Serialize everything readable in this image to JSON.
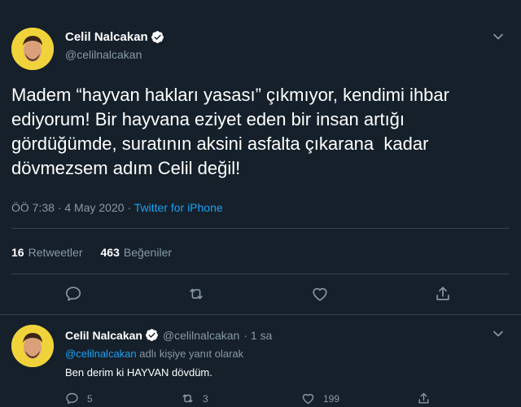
{
  "tweet": {
    "author": {
      "name": "Celil Nalcakan",
      "handle": "@celilnalcakan",
      "verified": true
    },
    "text": "Madem “hayvan hakları yasası” çıkmıyor, kendimi ihbar\nediyorum! Bir hayvana eziyet eden bir insan artığı\ngördüğümde, suratının aksini asfalta çıkarana  kadar\ndövmezsem adım Celil değil!",
    "time_date": "ÖÖ 7:38 · 4 May 2020 · ",
    "source": "Twitter for iPhone",
    "stats": {
      "retweets_count": "16",
      "retweets_label": "Retweetler",
      "likes_count": "463",
      "likes_label": "Beğeniler"
    },
    "actions": [
      "reply-icon",
      "retweet-icon",
      "like-icon",
      "share-icon"
    ]
  },
  "reply": {
    "author": {
      "name": "Celil Nalcakan",
      "handle": "@celilnalcakan",
      "verified": true
    },
    "time": "· 1 sa",
    "reply_to_mention": "@celilnalcakan",
    "reply_to_suffix": " adlı kişiye yanıt olarak",
    "text": "Ben derim ki HAYVAN dövdüm.",
    "counts": {
      "replies": "5",
      "retweets": "3",
      "likes": "199"
    }
  },
  "colors": {
    "background": "#15202b",
    "text": "#ffffff",
    "secondary_text": "#8899a6",
    "accent": "#1da1f2",
    "divider": "#38444d",
    "avatar_bg": "#f0d33a"
  }
}
